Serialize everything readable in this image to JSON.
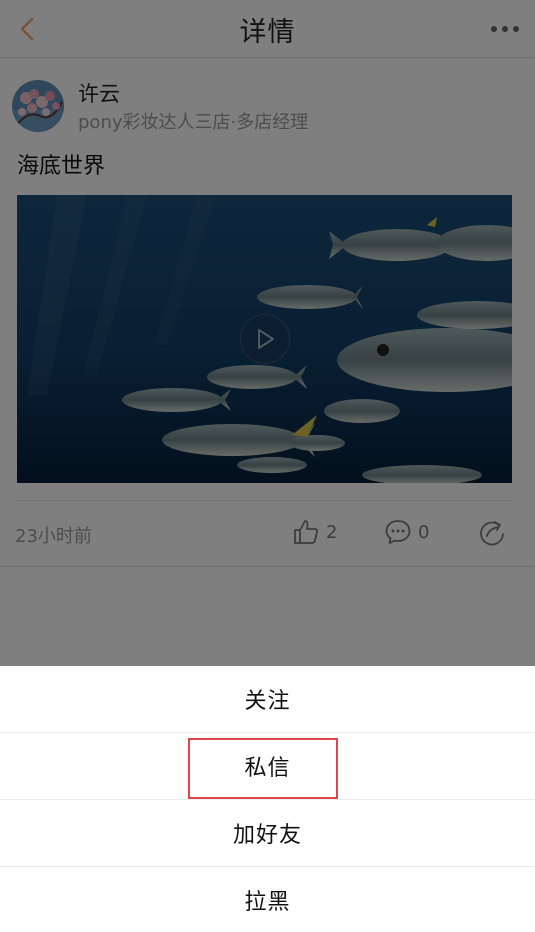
{
  "header": {
    "title": "详情",
    "back_icon": "chevron-left-icon",
    "more_icon": "more-dots-icon",
    "accent_color": "#f0a66a"
  },
  "post": {
    "author_name": "许云",
    "author_subtitle": "pony彩妆达人三店·多店经理",
    "text": "海底世界",
    "time": "23小时前",
    "like_count": "2",
    "comment_count": "0",
    "play_icon": "play-icon",
    "like_icon": "thumbs-up-icon",
    "comment_icon": "comment-icon",
    "share_icon": "share-icon"
  },
  "action_sheet": {
    "items": [
      {
        "label": "关注"
      },
      {
        "label": "私信"
      },
      {
        "label": "加好友"
      },
      {
        "label": "拉黑"
      }
    ],
    "highlight_color": "#e0474c"
  }
}
